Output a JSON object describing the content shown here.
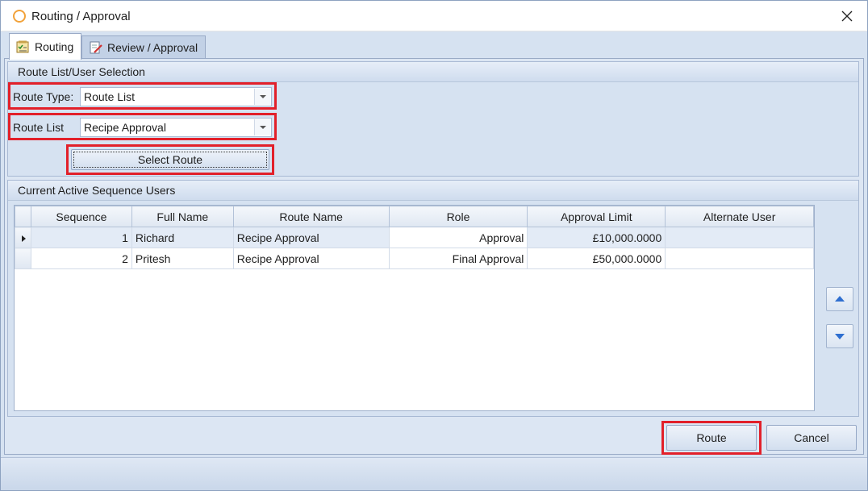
{
  "window": {
    "title": "Routing / Approval"
  },
  "tabs": [
    {
      "label": "Routing",
      "icon": "checklist-icon",
      "active": true
    },
    {
      "label": "Review / Approval",
      "icon": "document-pencil-icon",
      "active": false
    }
  ],
  "route_selection": {
    "header": "Route List/User Selection",
    "route_type_label": "Route Type:",
    "route_type_value": "Route List",
    "route_list_label": "Route List",
    "route_list_value": "Recipe Approval",
    "select_route_label": "Select Route"
  },
  "sequence_users": {
    "header": "Current Active Sequence Users",
    "columns": [
      "Sequence",
      "Full Name",
      "Route Name",
      "Role",
      "Approval Limit",
      "Alternate User"
    ],
    "rows": [
      {
        "sequence": "1",
        "full_name": "Richard",
        "route_name": "Recipe Approval",
        "role": "Approval",
        "approval_limit": "£10,000.0000",
        "alternate_user": ""
      },
      {
        "sequence": "2",
        "full_name": "Pritesh",
        "route_name": "Recipe Approval",
        "role": "Final Approval",
        "approval_limit": "£50,000.0000",
        "alternate_user": ""
      }
    ]
  },
  "footer": {
    "route_label": "Route",
    "cancel_label": "Cancel"
  },
  "colors": {
    "highlight": "#e2202a",
    "accent": "#f2a23a",
    "arrow": "#2f6fd0"
  }
}
